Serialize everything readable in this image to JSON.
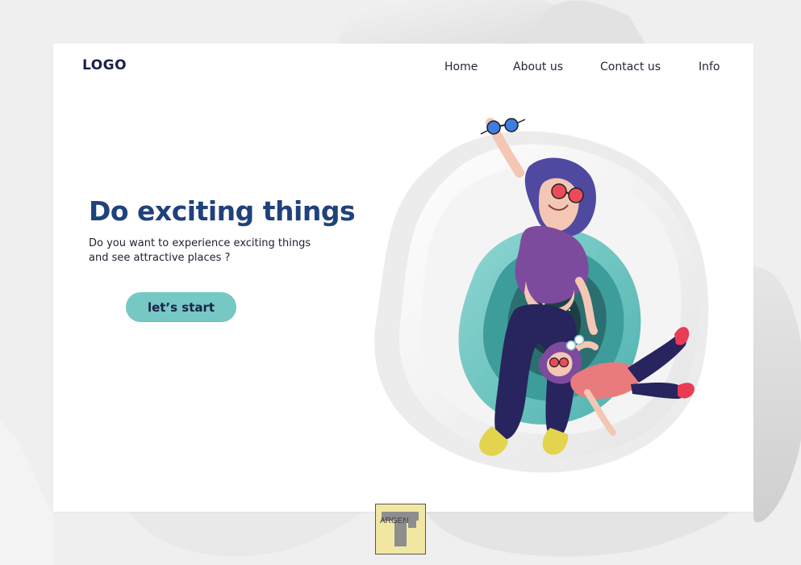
{
  "header": {
    "logo": "LOGO",
    "nav": {
      "home": "Home",
      "about": "About us",
      "contact": "Contact us",
      "info": "Info"
    }
  },
  "hero": {
    "title": "Do exciting things",
    "subtitle_line1": "Do you want to experience exciting things",
    "subtitle_line2": "and see attractive places  ?",
    "cta_label": "let’s start"
  },
  "watermark": {
    "text": "ARGEN"
  },
  "colors": {
    "background": "#efefef",
    "card": "#ffffff",
    "title": "#20427b",
    "button": "#75c8c4",
    "teal_portal": "#55b6b2",
    "shirt_purple": "#7d4b9e",
    "pants_navy": "#28245e",
    "shoe_yellow": "#e3d44e",
    "lens_red": "#ec4a5b"
  },
  "illustration": {
    "icon": "travel-illustration-icon",
    "depicts": "floating-friends-in-portal"
  }
}
